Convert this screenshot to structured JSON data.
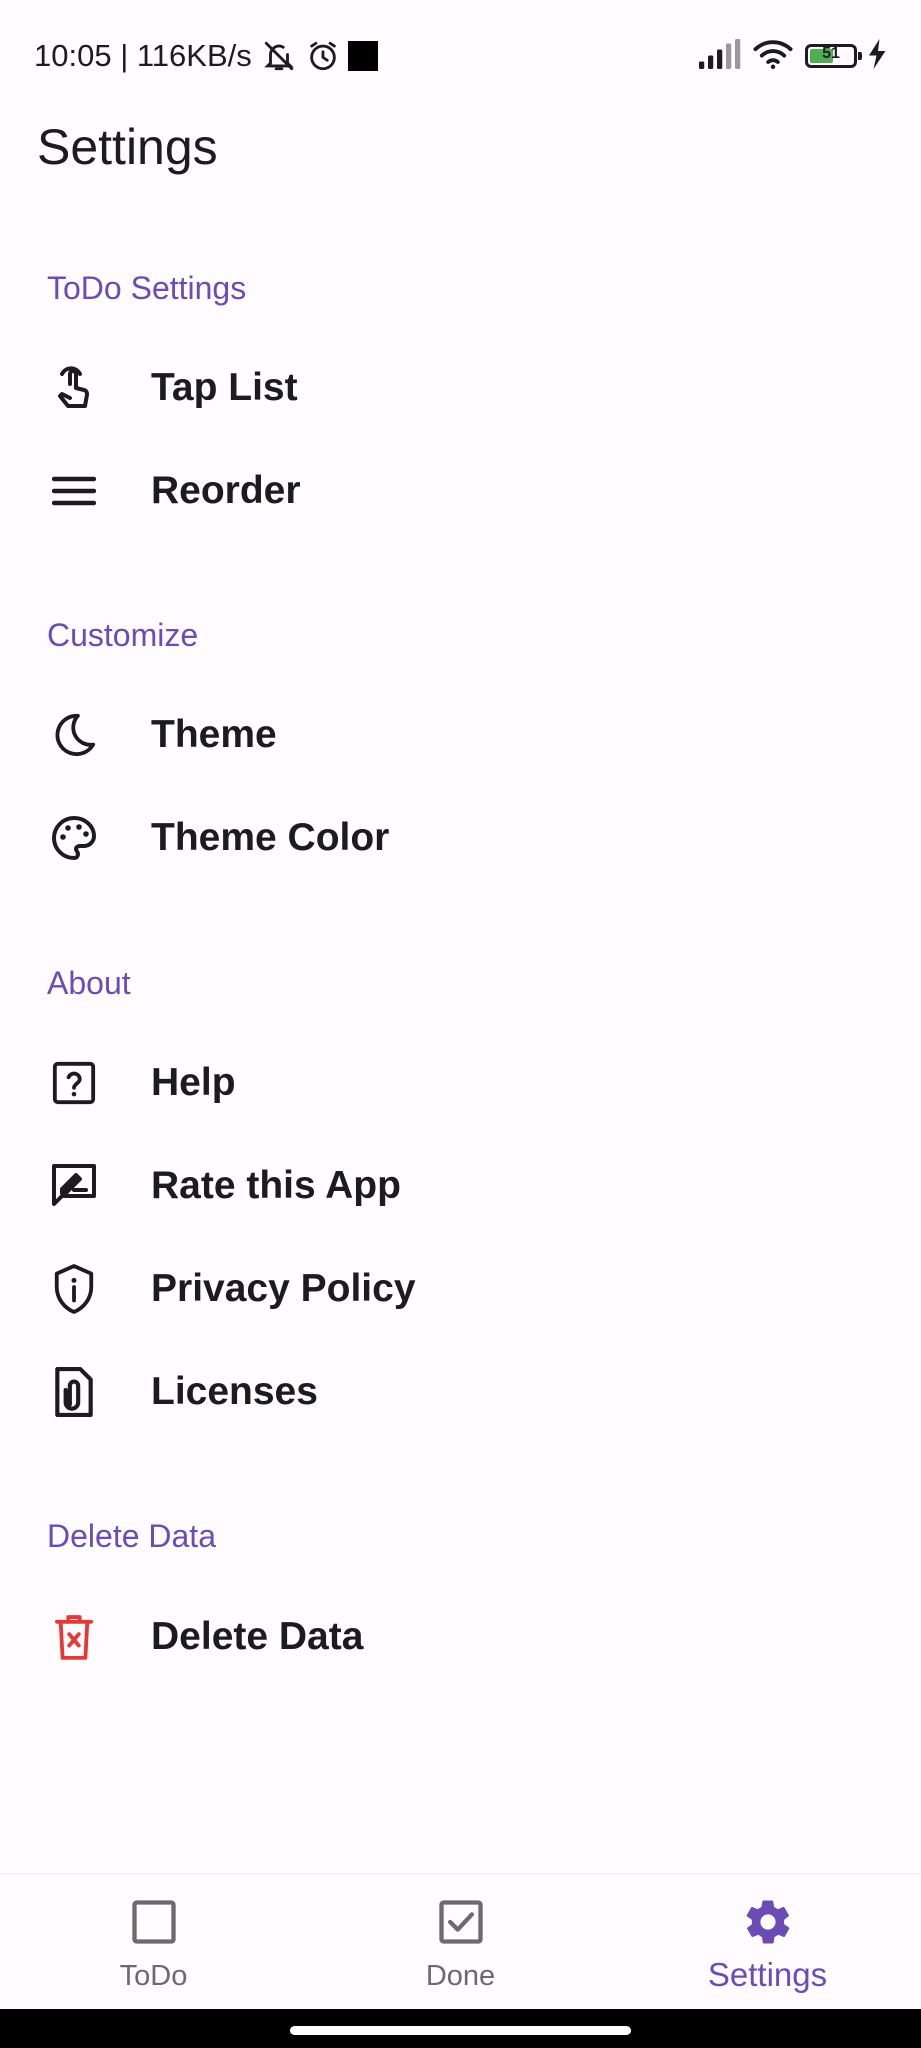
{
  "status_bar": {
    "time_speed": "10:05 | 116KB/s",
    "battery_level": "51",
    "icons": [
      "notifications-off-icon",
      "alarm-icon",
      "square-indicator-icon",
      "signal-icon",
      "wifi-icon",
      "battery-icon",
      "charging-icon"
    ]
  },
  "page": {
    "title": "Settings"
  },
  "sections": {
    "todo": {
      "header": "ToDo Settings",
      "items": [
        {
          "label": "Tap List",
          "icon": "touch-icon"
        },
        {
          "label": "Reorder",
          "icon": "reorder-icon"
        }
      ]
    },
    "customize": {
      "header": "Customize",
      "items": [
        {
          "label": "Theme",
          "icon": "moon-icon"
        },
        {
          "label": "Theme Color",
          "icon": "palette-icon"
        }
      ]
    },
    "about": {
      "header": "About",
      "items": [
        {
          "label": "Help",
          "icon": "help-icon"
        },
        {
          "label": "Rate this App",
          "icon": "rate-review-icon"
        },
        {
          "label": "Privacy Policy",
          "icon": "shield-icon"
        },
        {
          "label": "Licenses",
          "icon": "file-clip-icon"
        }
      ]
    },
    "delete": {
      "header": "Delete Data",
      "items": [
        {
          "label": "Delete Data",
          "icon": "delete-icon"
        }
      ]
    }
  },
  "bottom_nav": {
    "items": [
      {
        "label": "ToDo",
        "icon": "checkbox-empty-icon",
        "active": false
      },
      {
        "label": "Done",
        "icon": "checkbox-checked-icon",
        "active": false
      },
      {
        "label": "Settings",
        "icon": "gear-icon",
        "active": true
      }
    ]
  },
  "colors": {
    "accent": "#6a4cb6",
    "danger": "#e53935",
    "text": "#1c1b1f",
    "muted": "#6b6b6b",
    "background": "#fffbfe",
    "battery_fill": "#4caf50"
  }
}
